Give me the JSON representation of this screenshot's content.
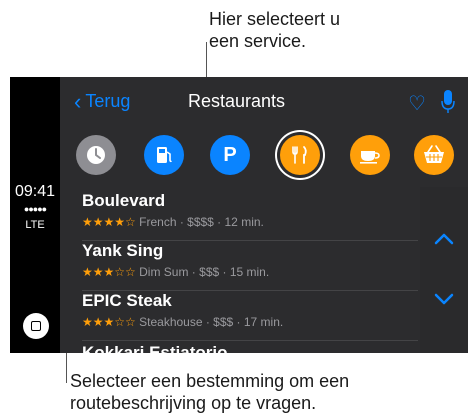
{
  "callouts": {
    "top_line1": "Hier selecteert u",
    "top_line2": "een service.",
    "bottom_line1": "Selecteer een bestemming om een",
    "bottom_line2": "routebeschrijving op te vragen."
  },
  "status": {
    "time": "09:41",
    "signal": "●●●●●",
    "network": "LTE"
  },
  "nav": {
    "back_label": "Terug",
    "title": "Restaurants"
  },
  "services": [
    {
      "name": "recent",
      "icon": "clock-icon",
      "color": "#8e8e93"
    },
    {
      "name": "gas",
      "icon": "fuel-icon",
      "color": "#0a84ff"
    },
    {
      "name": "parking",
      "icon": "parking-icon",
      "color": "#0a84ff",
      "label": "P"
    },
    {
      "name": "restaurants",
      "icon": "fork-knife-icon",
      "color": "#ff9f0a",
      "selected": true
    },
    {
      "name": "coffee",
      "icon": "coffee-icon",
      "color": "#ff9f0a"
    },
    {
      "name": "shopping",
      "icon": "basket-icon",
      "color": "#ff9f0a"
    }
  ],
  "restaurants": [
    {
      "name": "Boulevard",
      "stars": "★★★★☆",
      "details": "French · $$$$ · 12 min."
    },
    {
      "name": "Yank Sing",
      "stars": "★★★☆☆",
      "details": "Dim Sum · $$$ · 15 min."
    },
    {
      "name": "EPIC Steak",
      "stars": "★★★☆☆",
      "details": "Steakhouse · $$$ · 17 min."
    },
    {
      "name": "Kokkari Estiatorio",
      "stars": "",
      "details": ""
    }
  ]
}
